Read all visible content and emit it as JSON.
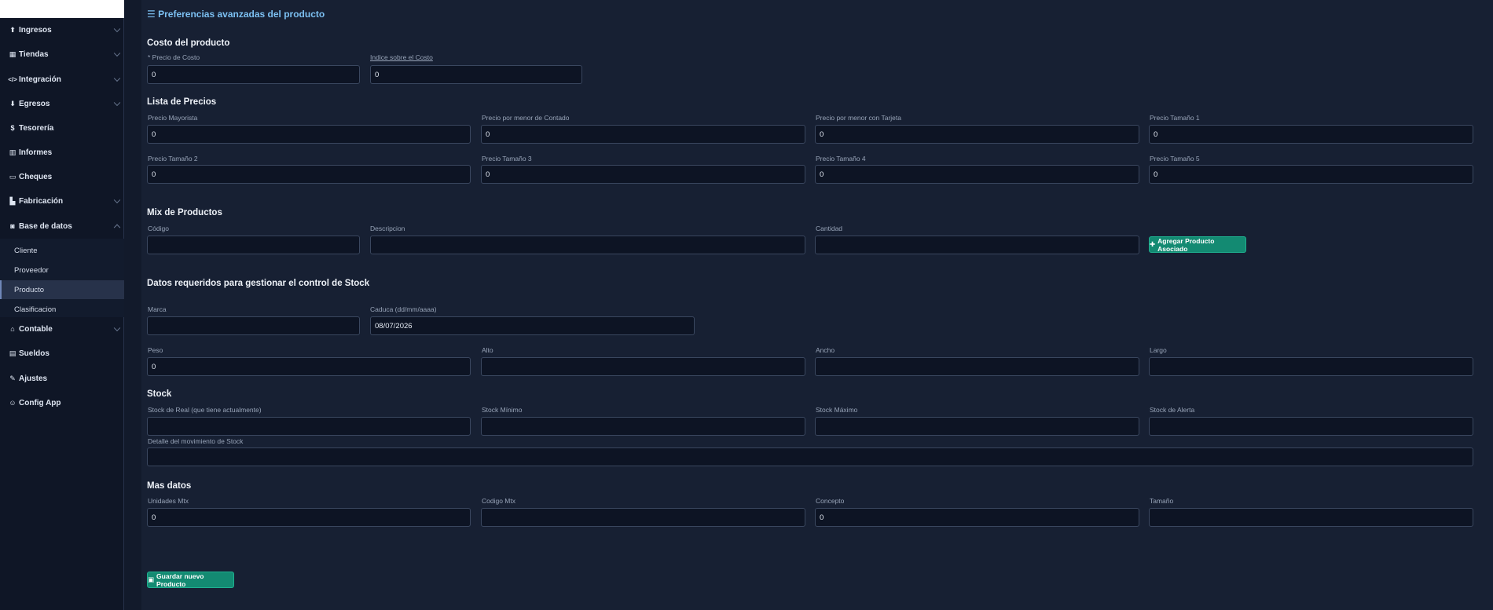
{
  "sidebar": {
    "items": [
      {
        "label": "Ingresos",
        "icon": "upload-icon",
        "glyph": "⬆",
        "expanded": false
      },
      {
        "label": "Tiendas",
        "icon": "store-icon",
        "glyph": "▦",
        "expanded": false
      },
      {
        "label": "Integración",
        "icon": "code-icon",
        "glyph": "</>",
        "expanded": false
      },
      {
        "label": "Egresos",
        "icon": "download-icon",
        "glyph": "⬇",
        "expanded": false
      },
      {
        "label": "Tesorería",
        "icon": "dollar-icon",
        "glyph": "$",
        "expanded": false
      },
      {
        "label": "Informes",
        "icon": "chart-icon",
        "glyph": "▥",
        "expanded": false
      },
      {
        "label": "Cheques",
        "icon": "card-icon",
        "glyph": "▭",
        "expanded": false
      },
      {
        "label": "Fabricación",
        "icon": "factory-icon",
        "glyph": "▙",
        "expanded": false
      },
      {
        "label": "Base de datos",
        "icon": "database-icon",
        "glyph": "◙",
        "expanded": true
      },
      {
        "label": "Contable",
        "icon": "bank-icon",
        "glyph": "⌂",
        "expanded": false
      },
      {
        "label": "Sueldos",
        "icon": "book-icon",
        "glyph": "▤",
        "expanded": false
      },
      {
        "label": "Ajustes",
        "icon": "wrench-icon",
        "glyph": "✎",
        "expanded": false
      },
      {
        "label": "Config App",
        "icon": "robot-icon",
        "glyph": "☺",
        "expanded": false
      }
    ],
    "submenu": [
      "Cliente",
      "Proveedor",
      "Producto",
      "Clasificacion"
    ],
    "active_sub": "Producto"
  },
  "header": {
    "title": "Preferencias avanzadas del producto",
    "icon": "sliders-icon",
    "glyph": "☰"
  },
  "costo": {
    "title": "Costo del producto",
    "precio_costo_label": "* Precio de Costo",
    "precio_costo_value": "0",
    "indice_label": "Indice sobre el Costo",
    "indice_value": "0"
  },
  "precios": {
    "title": "Lista de Precios",
    "fields": [
      {
        "label": "Precio Mayorista",
        "value": "0"
      },
      {
        "label": "Precio por menor de Contado",
        "value": "0"
      },
      {
        "label": "Precio por menor con Tarjeta",
        "value": "0"
      },
      {
        "label": "Precio Tamaño 1",
        "value": "0"
      },
      {
        "label": "Precio Tamaño 2",
        "value": "0"
      },
      {
        "label": "Precio Tamaño 3",
        "value": "0"
      },
      {
        "label": "Precio Tamaño 4",
        "value": "0"
      },
      {
        "label": "Precio Tamaño 5",
        "value": "0"
      }
    ]
  },
  "mix": {
    "title": "Mix de Productos",
    "codigo_label": "Código",
    "descripcion_label": "Descripcion",
    "cantidad_label": "Cantidad",
    "add_button": "Agregar Producto Asociado",
    "add_glyph": "✚"
  },
  "stock_ctrl": {
    "title": "Datos requeridos para gestionar el control de Stock",
    "marca_label": "Marca",
    "marca_value": "",
    "caduca_label": "Caduca (dd/mm/aaaa)",
    "caduca_value": "08/07/2026",
    "peso_label": "Peso",
    "peso_value": "0",
    "alto_label": "Alto",
    "ancho_label": "Ancho",
    "largo_label": "Largo"
  },
  "stock": {
    "title": "Stock",
    "real_label": "Stock de Real (que tiene actualmente)",
    "minimo_label": "Stock Mínimo",
    "maximo_label": "Stock Máximo",
    "alerta_label": "Stock de Alerta",
    "detalle_label": "Detalle del movimiento de Stock"
  },
  "mas": {
    "title": "Mas datos",
    "unidades_label": "Unidades Mtx",
    "unidades_value": "0",
    "codigo_label": "Codigo Mtx",
    "concepto_label": "Concepto",
    "concepto_value": "0",
    "tamano_label": "Tamaño"
  },
  "save_button": "Guardar nuevo Producto",
  "save_glyph": "▣"
}
